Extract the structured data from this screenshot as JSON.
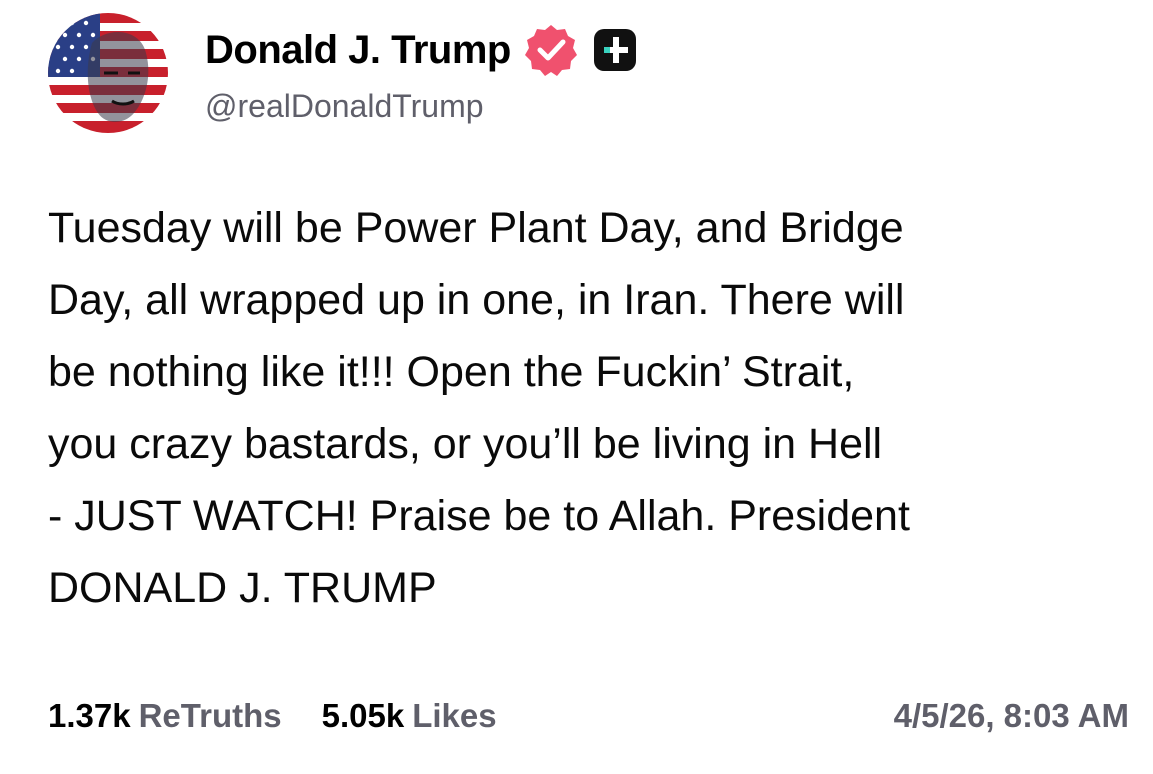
{
  "author": {
    "display_name": "Donald J. Trump",
    "handle": "@realDonaldTrump",
    "verified_icon": "verified-badge-icon",
    "badge_icon": "plus-badge-icon",
    "colors": {
      "verified": "#f0516e",
      "badge_bg": "#111111",
      "badge_accent": "#3ad3c0"
    }
  },
  "post": {
    "text": "Tuesday will be Power Plant Day, and Bridge\nDay, all wrapped up in one, in Iran. There will\nbe nothing like it!!! Open the Fuckin’ Strait,\nyou crazy bastards, or you’ll be living in Hell\n- JUST WATCH! Praise be to Allah. President\nDONALD J. TRUMP"
  },
  "stats": {
    "retruths_count": "1.37k",
    "retruths_label": "ReTruths",
    "likes_count": "5.05k",
    "likes_label": "Likes"
  },
  "timestamp": "4/5/26, 8:03 AM"
}
